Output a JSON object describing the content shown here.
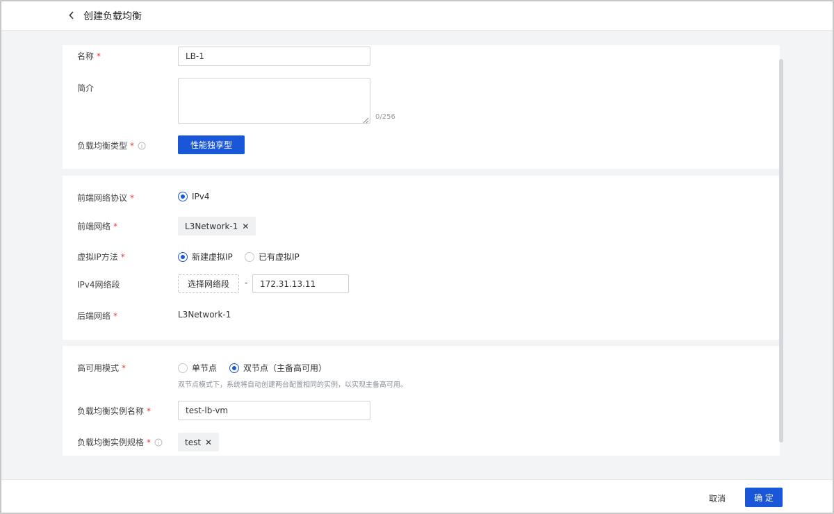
{
  "header": {
    "title": "创建负载均衡"
  },
  "basic": {
    "name_label": "名称",
    "name_value": "LB-1",
    "desc_label": "简介",
    "desc_counter": "0/256",
    "lb_type_label": "负载均衡类型",
    "lb_type_button": "性能独享型"
  },
  "network": {
    "frontend_protocol_label": "前端网络协议",
    "frontend_protocol_option": "IPv4",
    "frontend_network_label": "前端网络",
    "frontend_network_tag": "L3Network-1",
    "vip_method_label": "虚拟IP方法",
    "vip_option_new": "新建虚拟IP",
    "vip_option_existing": "已有虚拟IP",
    "ipv4_segment_label": "IPv4网络段",
    "select_segment_button": "选择网络段",
    "segment_dash": "-",
    "ipv4_value": "172.31.13.11",
    "backend_network_label": "后端网络",
    "backend_network_value": "L3Network-1"
  },
  "ha": {
    "ha_mode_label": "高可用模式",
    "ha_option_single": "单节点",
    "ha_option_dual": "双节点（主备高可用）",
    "ha_hint": "双节点模式下，系统将自动创建两台配置相同的实例，以实现主备高可用。",
    "instance_name_label": "负载均衡实例名称",
    "instance_name_value": "test-lb-vm",
    "instance_spec_label": "负载均衡实例规格",
    "instance_spec_tag": "test"
  },
  "footer": {
    "cancel_label": "取消",
    "confirm_label": "确 定"
  },
  "colors": {
    "primary": "#1a57d8",
    "required": "#e23c39",
    "page_bg": "#f3f4f6"
  },
  "icons": {
    "back": "chevron-left-icon",
    "info": "info-icon",
    "remove": "close-icon"
  }
}
